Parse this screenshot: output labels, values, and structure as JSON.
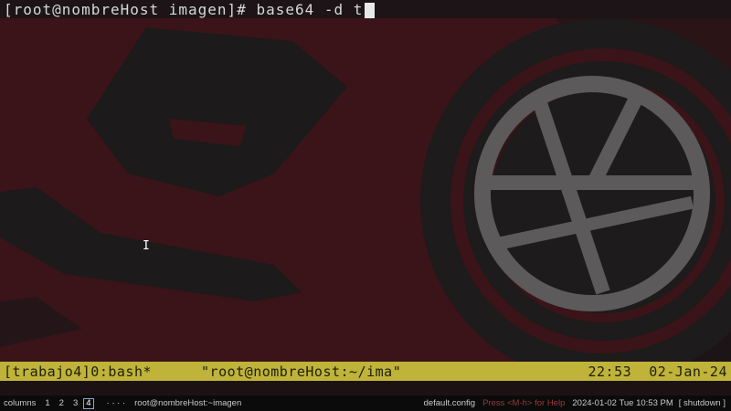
{
  "terminal": {
    "prompt_line": "[root@nombreHost imagen]# base64 -d t"
  },
  "tmux": {
    "session": "[trabajo4]0:bash*",
    "title": "\"root@nombreHost:~/ima\"",
    "time": "22:53  02-Jan-24"
  },
  "panel": {
    "menu_label": "columns",
    "workspaces": [
      "1",
      "2",
      "3",
      "4"
    ],
    "active_workspace": "4",
    "extra_dots": "·  ·  ·  ·",
    "window_title": "root@nombreHost:~imagen",
    "config": "default.config",
    "hint": "Press <M-h> for Help",
    "clock": "2024-01-02 Tue 10:53 PM",
    "shutdown": "[ shutdown ]"
  },
  "colors": {
    "wallpaper_red": "#3a1418",
    "wallpaper_dark": "#1e1c1c",
    "tmux_status": "#bfb339",
    "emblem_gray": "#5c5a5a"
  }
}
